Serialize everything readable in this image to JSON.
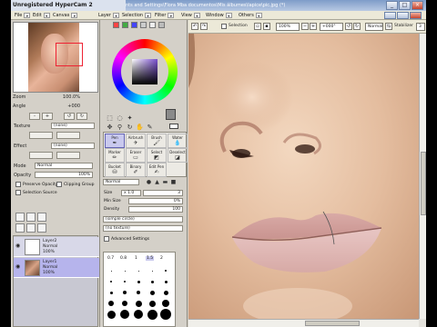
{
  "titlebar": {
    "recorder": "Unregistered HyperCam 2",
    "document": "nts and Settings\\Flora Mba documentos\\Mis álbumes\\lapice\\pic.jpg (*)"
  },
  "menubar": {
    "items": [
      "File",
      "Edit",
      "Canvas",
      "Layer",
      "Selection",
      "Filter",
      "View",
      "Window",
      "Others"
    ]
  },
  "navigator": {
    "zoom_label": "Zoom",
    "zoom_value": "100.0%",
    "angle_label": "Angle",
    "angle_value": "+000"
  },
  "layer_props": {
    "texture_label": "Texture",
    "texture_value": "(none)",
    "effect_label": "Effect",
    "effect_value": "(none)",
    "mode_label": "Mode",
    "mode_value": "Normal",
    "opacity_label": "Opacity",
    "opacity_value": "100%",
    "preserve_opacity": "Preserve Opacity",
    "clipping_group": "Clipping Group",
    "selection_source": "Selection Source"
  },
  "layers": [
    {
      "name": "Layer2",
      "mode": "Normal",
      "opacity": "100%"
    },
    {
      "name": "Layer1",
      "mode": "Normal",
      "opacity": "100%"
    }
  ],
  "brush_tools": [
    [
      "Pen",
      "Airbrush",
      "Brush",
      "Water"
    ],
    [
      "Marker",
      "Eraser",
      "Select",
      "Deselect"
    ],
    [
      "Bucket",
      "Binary",
      "Edit Pen",
      ""
    ]
  ],
  "tool_options": {
    "blend_mode": "Normal",
    "size_label": "Size",
    "size_multiplier": "x 1.0",
    "size_value": "3",
    "min_size_label": "Min Size",
    "min_size_value": "0%",
    "density_label": "Density",
    "density_value": "100",
    "shape": "(simple circle)",
    "texture": "(no texture)",
    "advanced": "Advanced Settings",
    "dot_sizes": [
      "0.7",
      "0.8",
      "1",
      "1.5",
      "2"
    ]
  },
  "canvas_toolbar": {
    "selection_label": "Selection",
    "zoom_value": "100%",
    "angle_value": "+000°",
    "blend_value": "Normal",
    "stabilizer_label": "Stabilizer",
    "stabilizer_value": "3"
  },
  "colors": {
    "title_gradient_top": "#7e9cc9",
    "panel_bg": "#d4d0c8",
    "selected_layer": "#b6b4ec",
    "skin": "#e6c4a6",
    "lips": "#d8a6a2"
  }
}
